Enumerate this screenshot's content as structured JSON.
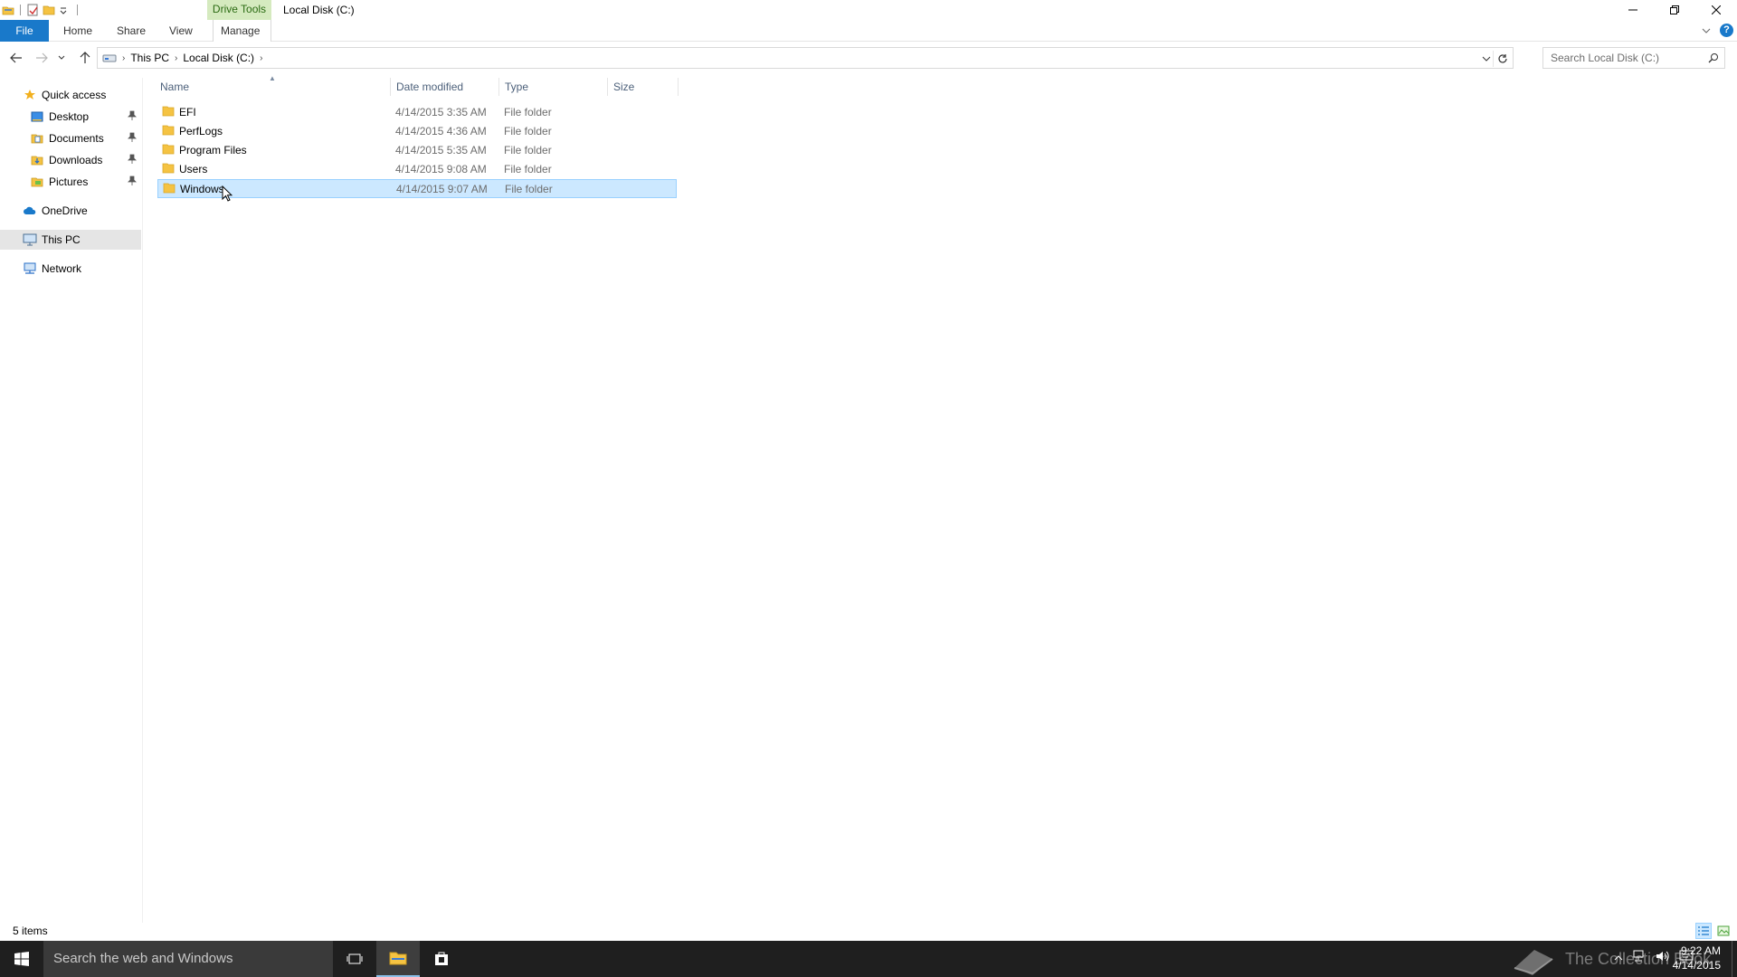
{
  "window": {
    "context_tab_group": "Drive Tools",
    "title": "Local Disk (C:)"
  },
  "ribbon": {
    "tabs": [
      {
        "label": "File"
      },
      {
        "label": "Home"
      },
      {
        "label": "Share"
      },
      {
        "label": "View"
      },
      {
        "label": "Manage"
      }
    ]
  },
  "address": {
    "crumbs": [
      "This PC",
      "Local Disk (C:)"
    ]
  },
  "search": {
    "placeholder": "Search Local Disk (C:)"
  },
  "nav_pane": {
    "quick_access": "Quick access",
    "pinned": [
      {
        "label": "Desktop",
        "icon": "desktop-icon"
      },
      {
        "label": "Documents",
        "icon": "documents-icon"
      },
      {
        "label": "Downloads",
        "icon": "downloads-icon"
      },
      {
        "label": "Pictures",
        "icon": "pictures-icon"
      }
    ],
    "onedrive": "OneDrive",
    "this_pc": "This PC",
    "network": "Network"
  },
  "columns": {
    "name": "Name",
    "date_modified": "Date modified",
    "type": "Type",
    "size": "Size"
  },
  "files": [
    {
      "name": "EFI",
      "date": "4/14/2015 3:35 AM",
      "type": "File folder",
      "size": ""
    },
    {
      "name": "PerfLogs",
      "date": "4/14/2015 4:36 AM",
      "type": "File folder",
      "size": ""
    },
    {
      "name": "Program Files",
      "date": "4/14/2015 5:35 AM",
      "type": "File folder",
      "size": ""
    },
    {
      "name": "Users",
      "date": "4/14/2015 9:08 AM",
      "type": "File folder",
      "size": ""
    },
    {
      "name": "Windows",
      "date": "4/14/2015 9:07 AM",
      "type": "File folder",
      "size": "",
      "selected": true
    }
  ],
  "status": {
    "item_count": "5 items"
  },
  "taskbar": {
    "search_placeholder": "Search the web and Windows",
    "watermark": "The Collection Book",
    "time": "9:22 AM",
    "date": "4/14/2015"
  },
  "colors": {
    "accent": "#1979ca",
    "selection_bg": "#cce8ff",
    "selection_border": "#99d1ff",
    "folder": "#f5c342",
    "context_tab_bg": "#d5eabf",
    "taskbar": "#1f1f1f"
  }
}
